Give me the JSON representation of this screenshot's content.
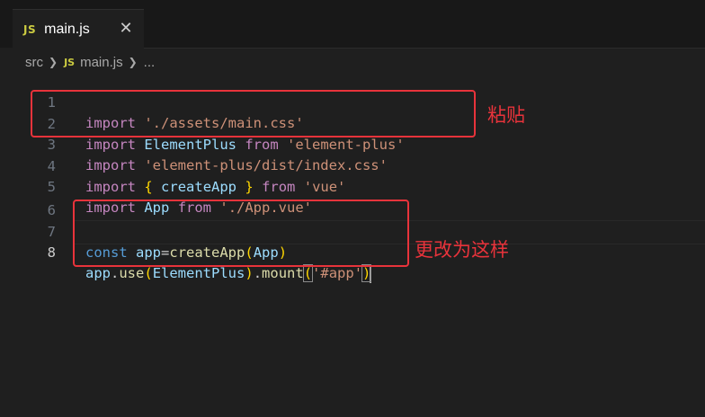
{
  "tab": {
    "badge": "JS",
    "label": "main.js",
    "close": "✕"
  },
  "breadcrumb": {
    "folder": "src",
    "separator": "❯",
    "badge": "JS",
    "file": "main.js",
    "ellipsis": "..."
  },
  "lines": [
    {
      "num": "1"
    },
    {
      "num": "2"
    },
    {
      "num": "3"
    },
    {
      "num": "4"
    },
    {
      "num": "5"
    },
    {
      "num": "6"
    },
    {
      "num": "7"
    },
    {
      "num": "8"
    }
  ],
  "code": {
    "l1": {
      "kw": "import",
      "str": "'./assets/main.css'"
    },
    "l2": {
      "kw": "import",
      "name": "ElementPlus",
      "from": "from",
      "str": "'element-plus'"
    },
    "l3": {
      "kw": "import",
      "str": "'element-plus/dist/index.css'"
    },
    "l4": {
      "kw": "import",
      "open": "{",
      "name": "createApp",
      "close": "}",
      "from": "from",
      "str": "'vue'"
    },
    "l5": {
      "kw": "import",
      "name": "App",
      "from": "from",
      "str": "'./App.vue'"
    },
    "l7": {
      "const": "const",
      "var": "app",
      "eq": "=",
      "fn": "createApp",
      "open": "(",
      "arg": "App",
      "close": ")"
    },
    "l8": {
      "var": "app",
      "dot1": ".",
      "fn1": "use",
      "open1": "(",
      "arg1": "ElementPlus",
      "close1": ")",
      "dot2": ".",
      "fn2": "mount",
      "open2": "(",
      "str": "'#app'",
      "close2": ")"
    }
  },
  "annotations": {
    "paste": "粘贴",
    "change": "更改为这样"
  },
  "colors": {
    "annotation_red": "#e8333b",
    "keyword": "#c586c0",
    "string": "#ce9178"
  }
}
